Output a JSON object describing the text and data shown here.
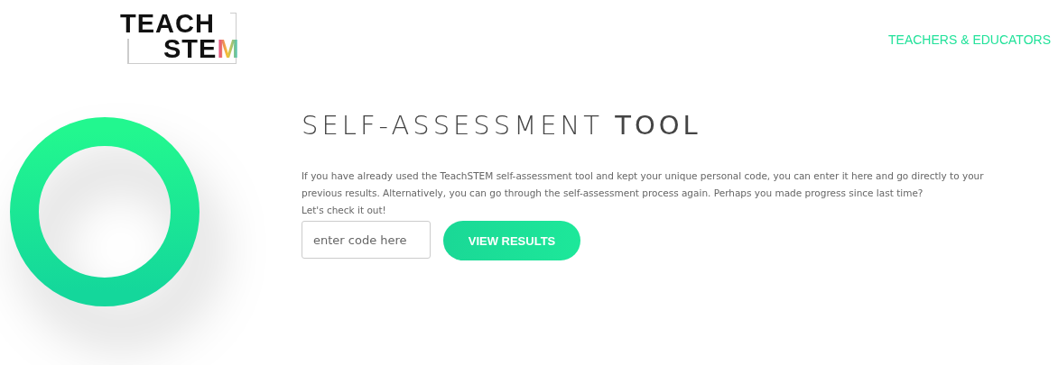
{
  "logo": {
    "line_1": "TEACH",
    "line_2": "STEM"
  },
  "nav": {
    "link": "TEACHERS & EDUCATORS"
  },
  "hero": {
    "title": "SELF-ASSESSMENT **TOOL**",
    "intro": "If you have already used the TeachSTEM self-assessment tool and kept your unique personal code, you can enter it here and go directly to your previous results. Alternatively, you can go through the self-assessment process again. Perhaps you made progress since last time?",
    "prompt": "Let's check it out!",
    "code_field": {
      "placeholder": "enter code here"
    },
    "button": "VIEW RESULTS"
  }
}
